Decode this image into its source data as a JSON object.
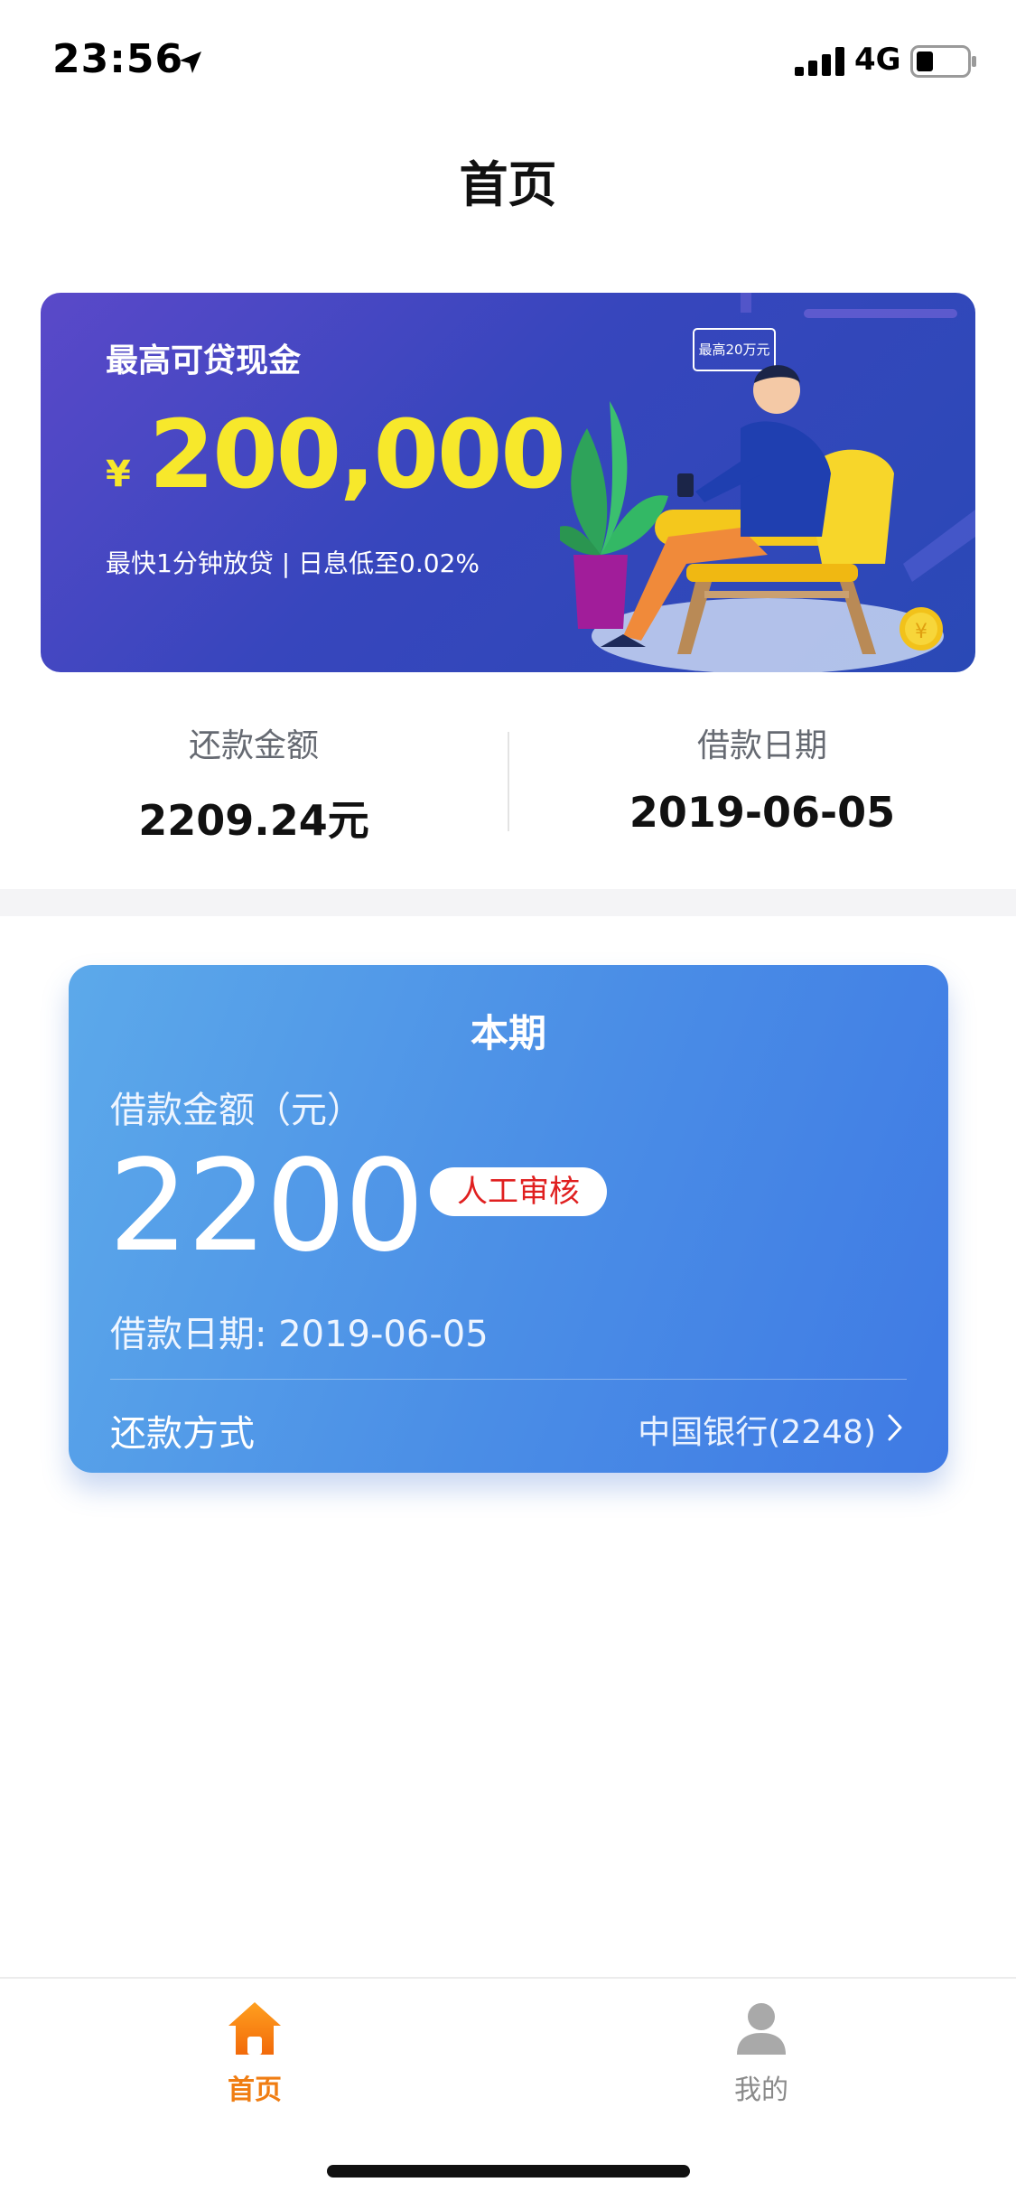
{
  "status_bar": {
    "time": "23:56",
    "network": "4G",
    "icons": [
      "location-arrow-icon",
      "cellular-signal-icon",
      "battery-icon"
    ]
  },
  "nav": {
    "title": "首页"
  },
  "banner": {
    "headline": "最高可贷现金",
    "currency_symbol": "¥",
    "amount": "200,000",
    "tagline": "最快1分钟放贷 | 日息低至0.02%",
    "bubble_text": "最高20万元",
    "colors": {
      "background_start": "#5a49c9",
      "background_end": "#2a49b6",
      "amount": "#f7e82b"
    }
  },
  "summary": {
    "repay_amount_label": "还款金额",
    "repay_amount_value": "2209.24元",
    "loan_date_label": "借款日期",
    "loan_date_value": "2019-06-05"
  },
  "period_card": {
    "title": "本期",
    "loan_amount_label": "借款金额（元）",
    "loan_amount": "2200",
    "status_badge": "人工审核",
    "loan_date_line": "借款日期: 2019-06-05",
    "repay_method_label": "还款方式",
    "repay_bank": "中国银行(2248)",
    "colors": {
      "gradient_start": "#5ca9ea",
      "gradient_end": "#3f7ae4",
      "badge_text": "#e02020"
    }
  },
  "tab_bar": {
    "items": [
      {
        "label": "首页",
        "icon": "home-icon",
        "active": true
      },
      {
        "label": "我的",
        "icon": "user-icon",
        "active": false
      }
    ],
    "active_color": "#f07d12",
    "inactive_color": "#8a8a8a"
  }
}
